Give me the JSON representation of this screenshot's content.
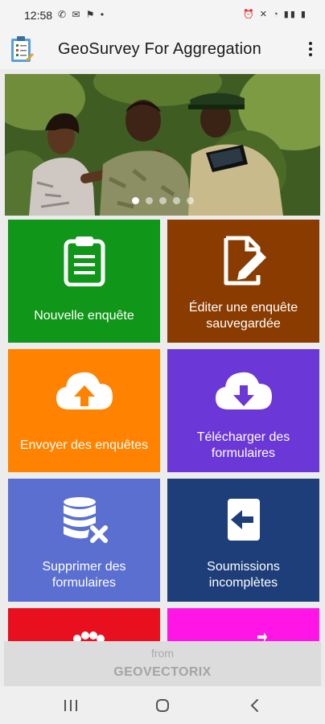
{
  "status_bar": {
    "time": "12:58",
    "left_icons": "✆ ✉ ⚑ •",
    "right_icons": "⏰ ✕ ◔ ▮▮ ▮"
  },
  "app_bar": {
    "title": "GeoSurvey For Aggregation",
    "logo_icon": "clipboard-app-icon",
    "menu_icon": "more-vert-icon"
  },
  "carousel": {
    "slide_count": 5,
    "active_index": 0
  },
  "tiles": [
    {
      "label_1": "Nouvelle enquête",
      "label_2": "",
      "icon": "clipboard-icon",
      "color": "#109618"
    },
    {
      "label_1": "Éditer une enquête",
      "label_2": "sauvegardée",
      "icon": "edit-document-icon",
      "color": "#8a3c00"
    },
    {
      "label_1": "Envoyer des enquêtes",
      "label_2": "",
      "icon": "cloud-upload-icon",
      "color": "#ff8200"
    },
    {
      "label_1": "Télécharger des",
      "label_2": "formulaires",
      "icon": "cloud-download-icon",
      "color": "#6b37d6"
    },
    {
      "label_1": "Supprimer des",
      "label_2": "formulaires",
      "icon": "database-delete-icon",
      "color": "#5b6fd0"
    },
    {
      "label_1": "Soumissions",
      "label_2": "incomplètes",
      "icon": "exit-door-icon",
      "color": "#1d3e78"
    },
    {
      "label_1": "",
      "label_2": "",
      "icon": "partial-icon",
      "color": "#e8101f"
    },
    {
      "label_1": "",
      "label_2": "",
      "icon": "partial-icon",
      "color": "#ff16e6"
    }
  ],
  "footer": {
    "from": "from",
    "brand": "GEOVECTORIX"
  },
  "nav_bar": {
    "recents_icon": "recents-icon",
    "home_icon": "home-icon",
    "back_icon": "back-icon"
  }
}
